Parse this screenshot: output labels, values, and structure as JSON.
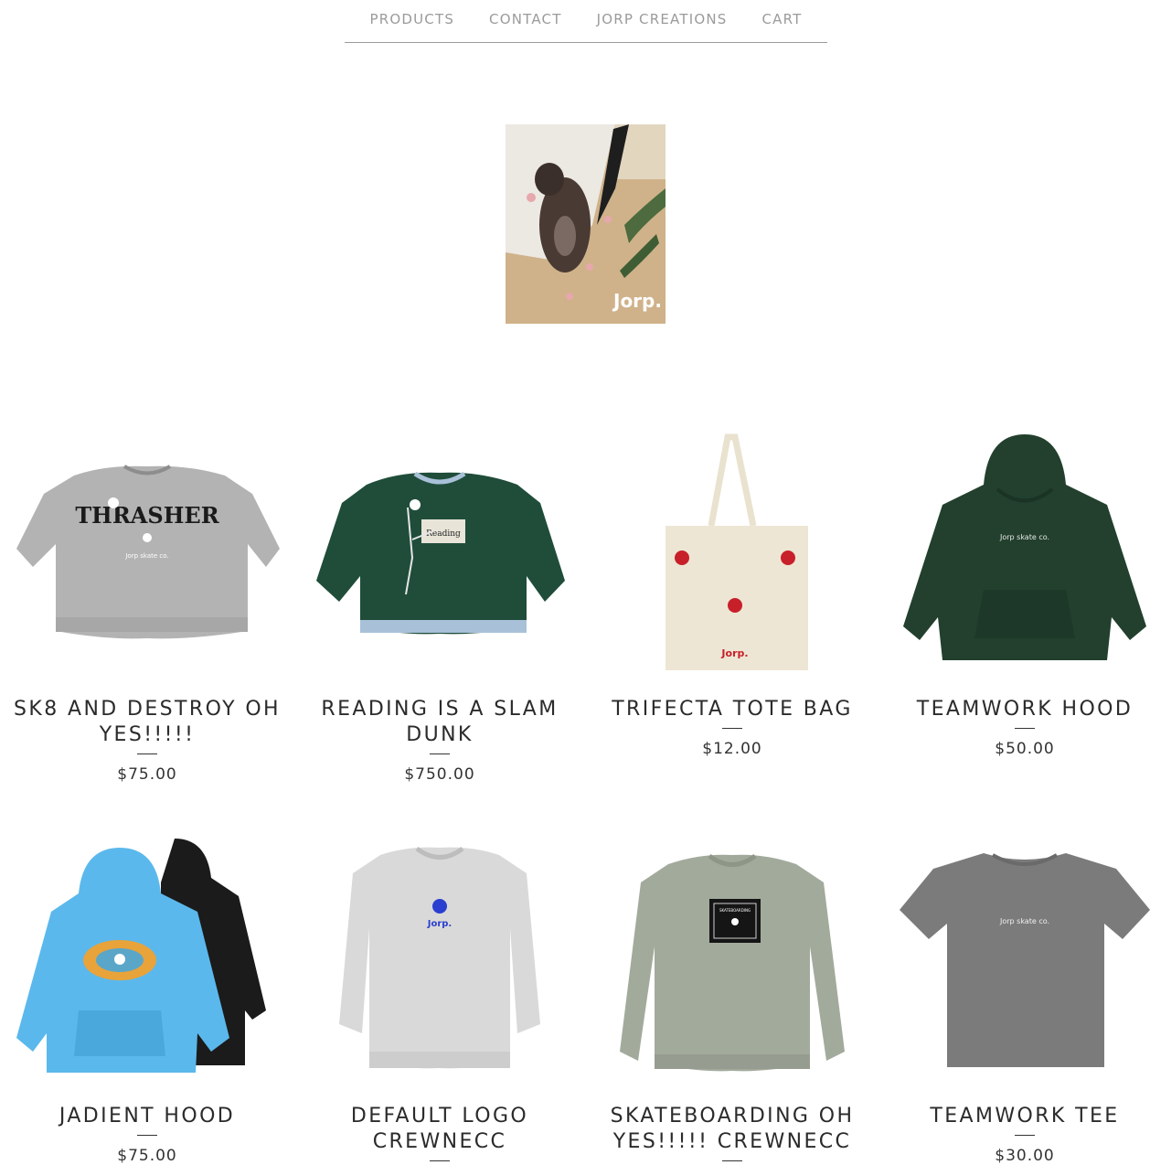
{
  "nav": {
    "items": [
      {
        "label": "PRODUCTS"
      },
      {
        "label": "CONTACT"
      },
      {
        "label": "JORP CREATIONS"
      },
      {
        "label": "CART"
      }
    ]
  },
  "logo": {
    "text": "Jorp."
  },
  "products": [
    {
      "title": "SK8 AND DESTROY OH YES!!!!!",
      "price": "$75.00",
      "image_text": "THRASHER"
    },
    {
      "title": "READING IS A SLAM DUNK",
      "price": "$750.00",
      "image_text": "Reading"
    },
    {
      "title": "TRIFECTA TOTE BAG",
      "price": "$12.00",
      "image_text": "Jorp."
    },
    {
      "title": "TEAMWORK HOOD",
      "price": "$50.00",
      "image_text": "Jorp skate co."
    },
    {
      "title": "JADIENT HOOD",
      "price": "$75.00",
      "image_text": ""
    },
    {
      "title": "DEFAULT LOGO CREWNECC",
      "price": "",
      "image_text": "Jorp."
    },
    {
      "title": "SKATEBOARDING OH YES!!!!! CREWNECC",
      "price": "",
      "image_text": "SKATEBOARDING"
    },
    {
      "title": "TEAMWORK TEE",
      "price": "$30.00",
      "image_text": "Jorp skate co."
    }
  ],
  "colors": {
    "nav_text": "#9b9b9b",
    "title_text": "#2b2b2b",
    "accent_red": "#c8202a",
    "accent_blue": "#2a3fd0"
  }
}
